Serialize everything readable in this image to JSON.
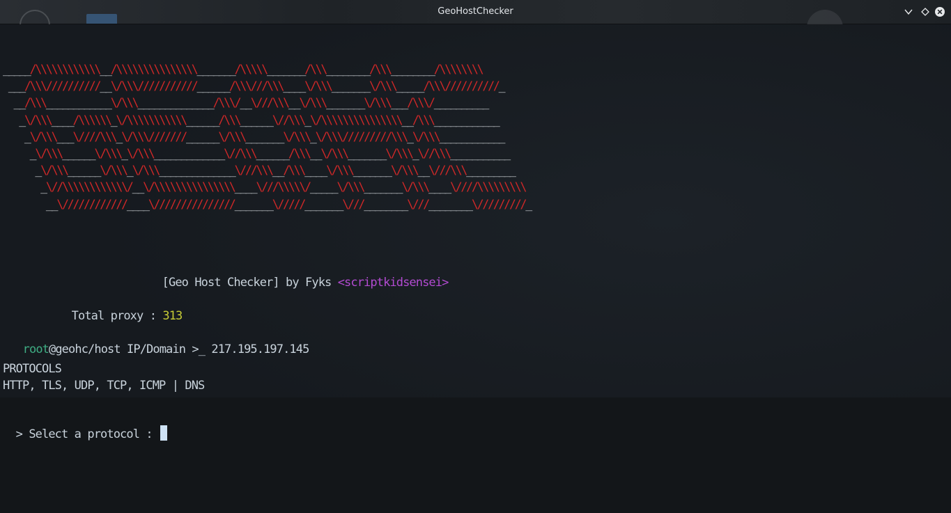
{
  "window": {
    "title": "GeoHostChecker",
    "buttons": {
      "minimize_icon": "chevron-down-icon",
      "maximize_icon": "diamond-icon",
      "close_icon": "close-icon"
    }
  },
  "banner": {
    "lines": [
      "_____/\\\\\\\\\\\\\\\\\\\\\\\\__/\\\\\\\\\\\\\\\\\\\\\\\\\\\\\\_______/\\\\\\\\\\_______/\\\\\\________/\\\\\\________/\\\\\\\\\\\\\\\\",
      " ___/\\\\\\//////////__\\/\\\\\\///////////______/\\\\\\///\\\\\\____\\/\\\\\\_______\\/\\\\\\_____/\\\\\\//////////_",
      "  __/\\\\\\____________\\/\\\\\\______________/\\\\\\/__\\///\\\\\\__\\/\\\\\\_______\\/\\\\\\___/\\\\\\/__________",
      "   _\\/\\\\\\____/\\\\\\\\\\\\_\\/\\\\\\\\\\\\\\\\\\\\\\______/\\\\\\______\\//\\\\\\_\\/\\\\\\\\\\\\\\\\\\\\\\\\\\\\\\__/\\\\\\____________",
      "    _\\/\\\\\\___\\////\\\\\\_\\/\\\\\\///////______\\/\\\\\\_______\\/\\\\\\_\\/\\\\\\/////////\\\\\\_\\/\\\\\\____________",
      "     _\\/\\\\\\______\\/\\\\\\_\\/\\\\\\_____________\\//\\\\\\______/\\\\\\__\\/\\\\\\_______\\/\\\\\\_\\//\\\\\\___________",
      "      _\\/\\\\\\______\\/\\\\\\_\\/\\\\\\______________\\///\\\\\\__/\\\\\\____\\/\\\\\\_______\\/\\\\\\__\\///\\\\\\_________",
      "       _\\//\\\\\\\\\\\\\\\\\\\\\\\\/__\\/\\\\\\\\\\\\\\\\\\\\\\\\\\\\\\____\\///\\\\\\\\\\/_____\\/\\\\\\_______\\/\\\\\\____\\////\\\\\\\\\\\\\\\\\\",
      "        __\\////////////____\\///////////////_______\\/////_______\\///________\\///________\\/////////_"
    ]
  },
  "info": {
    "header_prefix": "[Geo Host Checker] by Fyks ",
    "author_handle": "<scriptkidsensei>",
    "total_proxy_label": "Total proxy : ",
    "total_proxy_value": "313"
  },
  "prompt": {
    "user": "root",
    "rest": "@geohc/host IP/Domain >_ ",
    "host_value": "217.195.197.145"
  },
  "protocols": {
    "heading": "PROTOCOLS",
    "list": "HTTP, TLS, UDP, TCP, ICMP | DNS"
  },
  "select_prompt": {
    "label": "> Select a protocol : ",
    "input_value": ""
  }
}
